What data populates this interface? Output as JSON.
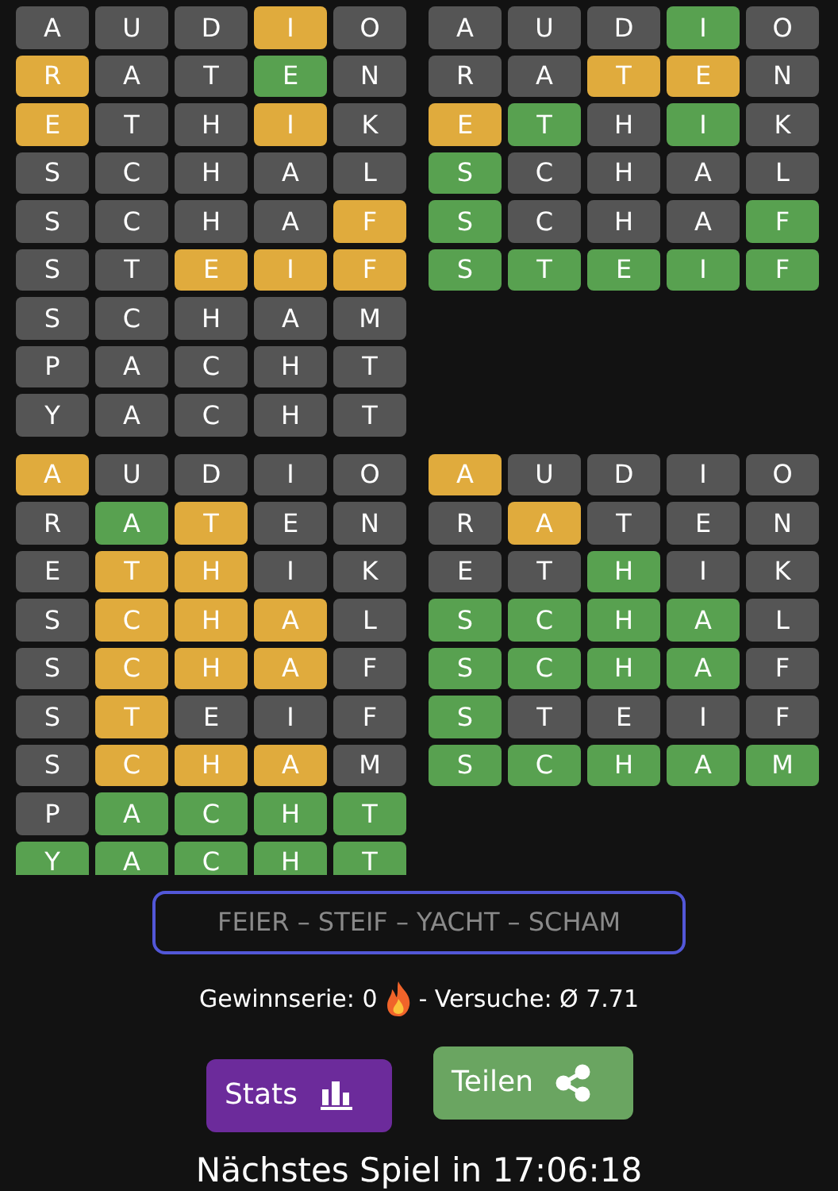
{
  "boards": [
    {
      "rows": [
        [
          {
            "letter": "A",
            "color": "#555555"
          },
          {
            "letter": "U",
            "color": "#555555"
          },
          {
            "letter": "D",
            "color": "#555555"
          },
          {
            "letter": "I",
            "color": "#e0ab3d"
          },
          {
            "letter": "O",
            "color": "#555555"
          }
        ],
        [
          {
            "letter": "R",
            "color": "#e0ab3d"
          },
          {
            "letter": "A",
            "color": "#555555"
          },
          {
            "letter": "T",
            "color": "#555555"
          },
          {
            "letter": "E",
            "color": "#58a150"
          },
          {
            "letter": "N",
            "color": "#555555"
          }
        ],
        [
          {
            "letter": "E",
            "color": "#e0ab3d"
          },
          {
            "letter": "T",
            "color": "#555555"
          },
          {
            "letter": "H",
            "color": "#555555"
          },
          {
            "letter": "I",
            "color": "#e0ab3d"
          },
          {
            "letter": "K",
            "color": "#555555"
          }
        ],
        [
          {
            "letter": "S",
            "color": "#555555"
          },
          {
            "letter": "C",
            "color": "#555555"
          },
          {
            "letter": "H",
            "color": "#555555"
          },
          {
            "letter": "A",
            "color": "#555555"
          },
          {
            "letter": "L",
            "color": "#555555"
          }
        ],
        [
          {
            "letter": "S",
            "color": "#555555"
          },
          {
            "letter": "C",
            "color": "#555555"
          },
          {
            "letter": "H",
            "color": "#555555"
          },
          {
            "letter": "A",
            "color": "#555555"
          },
          {
            "letter": "F",
            "color": "#e0ab3d"
          }
        ],
        [
          {
            "letter": "S",
            "color": "#555555"
          },
          {
            "letter": "T",
            "color": "#555555"
          },
          {
            "letter": "E",
            "color": "#e0ab3d"
          },
          {
            "letter": "I",
            "color": "#e0ab3d"
          },
          {
            "letter": "F",
            "color": "#e0ab3d"
          }
        ],
        [
          {
            "letter": "S",
            "color": "#555555"
          },
          {
            "letter": "C",
            "color": "#555555"
          },
          {
            "letter": "H",
            "color": "#555555"
          },
          {
            "letter": "A",
            "color": "#555555"
          },
          {
            "letter": "M",
            "color": "#555555"
          }
        ],
        [
          {
            "letter": "P",
            "color": "#555555"
          },
          {
            "letter": "A",
            "color": "#555555"
          },
          {
            "letter": "C",
            "color": "#555555"
          },
          {
            "letter": "H",
            "color": "#555555"
          },
          {
            "letter": "T",
            "color": "#555555"
          }
        ],
        [
          {
            "letter": "Y",
            "color": "#555555"
          },
          {
            "letter": "A",
            "color": "#555555"
          },
          {
            "letter": "C",
            "color": "#555555"
          },
          {
            "letter": "H",
            "color": "#555555"
          },
          {
            "letter": "T",
            "color": "#555555"
          }
        ]
      ]
    },
    {
      "rows": [
        [
          {
            "letter": "A",
            "color": "#555555"
          },
          {
            "letter": "U",
            "color": "#555555"
          },
          {
            "letter": "D",
            "color": "#555555"
          },
          {
            "letter": "I",
            "color": "#58a150"
          },
          {
            "letter": "O",
            "color": "#555555"
          }
        ],
        [
          {
            "letter": "R",
            "color": "#555555"
          },
          {
            "letter": "A",
            "color": "#555555"
          },
          {
            "letter": "T",
            "color": "#e0ab3d"
          },
          {
            "letter": "E",
            "color": "#e0ab3d"
          },
          {
            "letter": "N",
            "color": "#555555"
          }
        ],
        [
          {
            "letter": "E",
            "color": "#e0ab3d"
          },
          {
            "letter": "T",
            "color": "#58a150"
          },
          {
            "letter": "H",
            "color": "#555555"
          },
          {
            "letter": "I",
            "color": "#58a150"
          },
          {
            "letter": "K",
            "color": "#555555"
          }
        ],
        [
          {
            "letter": "S",
            "color": "#58a150"
          },
          {
            "letter": "C",
            "color": "#555555"
          },
          {
            "letter": "H",
            "color": "#555555"
          },
          {
            "letter": "A",
            "color": "#555555"
          },
          {
            "letter": "L",
            "color": "#555555"
          }
        ],
        [
          {
            "letter": "S",
            "color": "#58a150"
          },
          {
            "letter": "C",
            "color": "#555555"
          },
          {
            "letter": "H",
            "color": "#555555"
          },
          {
            "letter": "A",
            "color": "#555555"
          },
          {
            "letter": "F",
            "color": "#58a150"
          }
        ],
        [
          {
            "letter": "S",
            "color": "#58a150"
          },
          {
            "letter": "T",
            "color": "#58a150"
          },
          {
            "letter": "E",
            "color": "#58a150"
          },
          {
            "letter": "I",
            "color": "#58a150"
          },
          {
            "letter": "F",
            "color": "#58a150"
          }
        ]
      ]
    },
    {
      "rows": [
        [
          {
            "letter": "A",
            "color": "#e0ab3d"
          },
          {
            "letter": "U",
            "color": "#555555"
          },
          {
            "letter": "D",
            "color": "#555555"
          },
          {
            "letter": "I",
            "color": "#555555"
          },
          {
            "letter": "O",
            "color": "#555555"
          }
        ],
        [
          {
            "letter": "R",
            "color": "#555555"
          },
          {
            "letter": "A",
            "color": "#58a150"
          },
          {
            "letter": "T",
            "color": "#e0ab3d"
          },
          {
            "letter": "E",
            "color": "#555555"
          },
          {
            "letter": "N",
            "color": "#555555"
          }
        ],
        [
          {
            "letter": "E",
            "color": "#555555"
          },
          {
            "letter": "T",
            "color": "#e0ab3d"
          },
          {
            "letter": "H",
            "color": "#e0ab3d"
          },
          {
            "letter": "I",
            "color": "#555555"
          },
          {
            "letter": "K",
            "color": "#555555"
          }
        ],
        [
          {
            "letter": "S",
            "color": "#555555"
          },
          {
            "letter": "C",
            "color": "#e0ab3d"
          },
          {
            "letter": "H",
            "color": "#e0ab3d"
          },
          {
            "letter": "A",
            "color": "#e0ab3d"
          },
          {
            "letter": "L",
            "color": "#555555"
          }
        ],
        [
          {
            "letter": "S",
            "color": "#555555"
          },
          {
            "letter": "C",
            "color": "#e0ab3d"
          },
          {
            "letter": "H",
            "color": "#e0ab3d"
          },
          {
            "letter": "A",
            "color": "#e0ab3d"
          },
          {
            "letter": "F",
            "color": "#555555"
          }
        ],
        [
          {
            "letter": "S",
            "color": "#555555"
          },
          {
            "letter": "T",
            "color": "#e0ab3d"
          },
          {
            "letter": "E",
            "color": "#555555"
          },
          {
            "letter": "I",
            "color": "#555555"
          },
          {
            "letter": "F",
            "color": "#555555"
          }
        ],
        [
          {
            "letter": "S",
            "color": "#555555"
          },
          {
            "letter": "C",
            "color": "#e0ab3d"
          },
          {
            "letter": "H",
            "color": "#e0ab3d"
          },
          {
            "letter": "A",
            "color": "#e0ab3d"
          },
          {
            "letter": "M",
            "color": "#555555"
          }
        ],
        [
          {
            "letter": "P",
            "color": "#555555"
          },
          {
            "letter": "A",
            "color": "#58a150"
          },
          {
            "letter": "C",
            "color": "#58a150"
          },
          {
            "letter": "H",
            "color": "#58a150"
          },
          {
            "letter": "T",
            "color": "#58a150"
          }
        ],
        [
          {
            "letter": "Y",
            "color": "#58a150"
          },
          {
            "letter": "A",
            "color": "#58a150"
          },
          {
            "letter": "C",
            "color": "#58a150"
          },
          {
            "letter": "H",
            "color": "#58a150"
          },
          {
            "letter": "T",
            "color": "#58a150"
          }
        ]
      ]
    },
    {
      "rows": [
        [
          {
            "letter": "A",
            "color": "#e0ab3d"
          },
          {
            "letter": "U",
            "color": "#555555"
          },
          {
            "letter": "D",
            "color": "#555555"
          },
          {
            "letter": "I",
            "color": "#555555"
          },
          {
            "letter": "O",
            "color": "#555555"
          }
        ],
        [
          {
            "letter": "R",
            "color": "#555555"
          },
          {
            "letter": "A",
            "color": "#e0ab3d"
          },
          {
            "letter": "T",
            "color": "#555555"
          },
          {
            "letter": "E",
            "color": "#555555"
          },
          {
            "letter": "N",
            "color": "#555555"
          }
        ],
        [
          {
            "letter": "E",
            "color": "#555555"
          },
          {
            "letter": "T",
            "color": "#555555"
          },
          {
            "letter": "H",
            "color": "#58a150"
          },
          {
            "letter": "I",
            "color": "#555555"
          },
          {
            "letter": "K",
            "color": "#555555"
          }
        ],
        [
          {
            "letter": "S",
            "color": "#58a150"
          },
          {
            "letter": "C",
            "color": "#58a150"
          },
          {
            "letter": "H",
            "color": "#58a150"
          },
          {
            "letter": "A",
            "color": "#58a150"
          },
          {
            "letter": "L",
            "color": "#555555"
          }
        ],
        [
          {
            "letter": "S",
            "color": "#58a150"
          },
          {
            "letter": "C",
            "color": "#58a150"
          },
          {
            "letter": "H",
            "color": "#58a150"
          },
          {
            "letter": "A",
            "color": "#58a150"
          },
          {
            "letter": "F",
            "color": "#555555"
          }
        ],
        [
          {
            "letter": "S",
            "color": "#58a150"
          },
          {
            "letter": "T",
            "color": "#555555"
          },
          {
            "letter": "E",
            "color": "#555555"
          },
          {
            "letter": "I",
            "color": "#555555"
          },
          {
            "letter": "F",
            "color": "#555555"
          }
        ],
        [
          {
            "letter": "S",
            "color": "#58a150"
          },
          {
            "letter": "C",
            "color": "#58a150"
          },
          {
            "letter": "H",
            "color": "#58a150"
          },
          {
            "letter": "A",
            "color": "#58a150"
          },
          {
            "letter": "M",
            "color": "#58a150"
          }
        ]
      ]
    }
  ],
  "solution": {
    "value": "FEIER – STEIF – YACHT – SCHAM"
  },
  "stats": {
    "streak": "Gewinnserie: 0",
    "attempts": "- Versuche: Ø 7.71"
  },
  "buttons": [
    {
      "label": "Stats",
      "kind": "stats"
    },
    {
      "label": "Teilen",
      "kind": "share"
    }
  ],
  "next_game": "Nächstes Spiel in 17:06:18"
}
